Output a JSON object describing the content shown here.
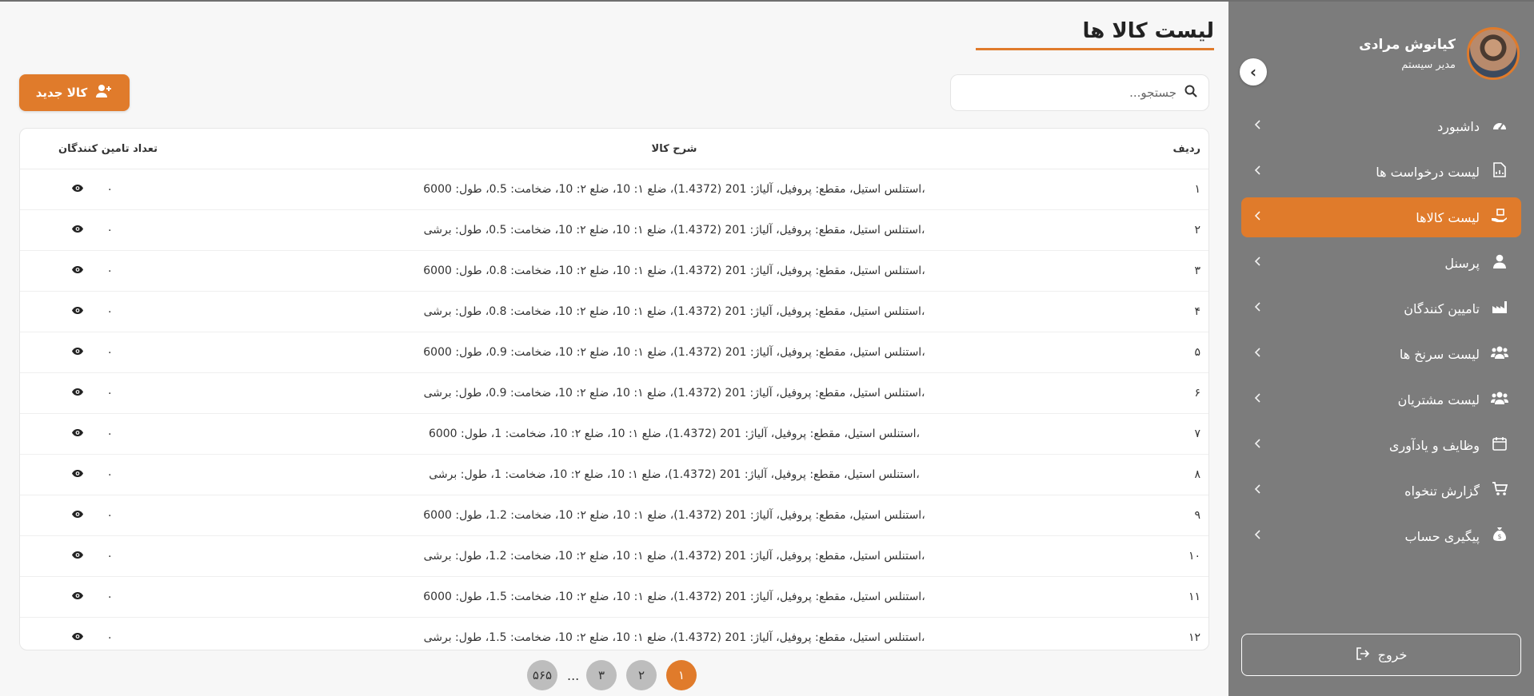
{
  "sidebar": {
    "profile": {
      "name": "کیانوش مرادی",
      "role": "مدیر سیستم"
    },
    "collapse_glyph": "‹",
    "items": [
      {
        "label": "داشبورد",
        "icon": "dashboard-icon"
      },
      {
        "label": "لیست درخواست ها",
        "icon": "document-icon"
      },
      {
        "label": "لیست کالاها",
        "icon": "hand-box-icon",
        "active": true
      },
      {
        "label": "پرسنل",
        "icon": "user-icon"
      },
      {
        "label": "تامیین کنندگان",
        "icon": "factory-icon"
      },
      {
        "label": "لیست سرنخ ها",
        "icon": "users-icon"
      },
      {
        "label": "لیست مشتریان",
        "icon": "users-icon"
      },
      {
        "label": "وظایف و یادآوری",
        "icon": "calendar-icon"
      },
      {
        "label": "گزارش تنخواه",
        "icon": "cart-icon"
      },
      {
        "label": "پیگیری حساب",
        "icon": "money-bag-icon"
      }
    ],
    "logout_label": "خروج"
  },
  "header": {
    "title": "لیست کالا ها"
  },
  "search": {
    "placeholder": "جستجو..."
  },
  "toolbar": {
    "new_label": "کالا جدید"
  },
  "table": {
    "columns": {
      "index": "ردیف",
      "description": "شرح کالا",
      "suppliers": "تعداد تامین کنندگان"
    },
    "rows": [
      {
        "index": "۱",
        "description": "استنلس استیل، مقطع: پروفیل، آلیاژ: 201 (1.4372)، ضلع ۱: 10، ضلع ۲: 10، ضخامت: 0.5، طول: 6000،",
        "suppliers": "۰"
      },
      {
        "index": "۲",
        "description": "استنلس استیل، مقطع: پروفیل، آلیاژ: 201 (1.4372)، ضلع ۱: 10، ضلع ۲: 10، ضخامت: 0.5، طول: برشی،",
        "suppliers": "۰"
      },
      {
        "index": "۳",
        "description": "استنلس استیل، مقطع: پروفیل، آلیاژ: 201 (1.4372)، ضلع ۱: 10، ضلع ۲: 10، ضخامت: 0.8، طول: 6000،",
        "suppliers": "۰"
      },
      {
        "index": "۴",
        "description": "استنلس استیل، مقطع: پروفیل، آلیاژ: 201 (1.4372)، ضلع ۱: 10، ضلع ۲: 10، ضخامت: 0.8، طول: برشی،",
        "suppliers": "۰"
      },
      {
        "index": "۵",
        "description": "استنلس استیل، مقطع: پروفیل، آلیاژ: 201 (1.4372)، ضلع ۱: 10، ضلع ۲: 10، ضخامت: 0.9، طول: 6000،",
        "suppliers": "۰"
      },
      {
        "index": "۶",
        "description": "استنلس استیل، مقطع: پروفیل، آلیاژ: 201 (1.4372)، ضلع ۱: 10، ضلع ۲: 10، ضخامت: 0.9، طول: برشی،",
        "suppliers": "۰"
      },
      {
        "index": "۷",
        "description": "استنلس استیل، مقطع: پروفیل، آلیاژ: 201 (1.4372)، ضلع ۱: 10، ضلع ۲: 10، ضخامت: 1، طول: 6000،",
        "suppliers": "۰"
      },
      {
        "index": "۸",
        "description": "استنلس استیل، مقطع: پروفیل، آلیاژ: 201 (1.4372)، ضلع ۱: 10، ضلع ۲: 10، ضخامت: 1، طول: برشی،",
        "suppliers": "۰"
      },
      {
        "index": "۹",
        "description": "استنلس استیل، مقطع: پروفیل، آلیاژ: 201 (1.4372)، ضلع ۱: 10، ضلع ۲: 10، ضخامت: 1.2، طول: 6000،",
        "suppliers": "۰"
      },
      {
        "index": "۱۰",
        "description": "استنلس استیل، مقطع: پروفیل، آلیاژ: 201 (1.4372)، ضلع ۱: 10، ضلع ۲: 10، ضخامت: 1.2، طول: برشی،",
        "suppliers": "۰"
      },
      {
        "index": "۱۱",
        "description": "استنلس استیل، مقطع: پروفیل، آلیاژ: 201 (1.4372)، ضلع ۱: 10، ضلع ۲: 10، ضخامت: 1.5، طول: 6000،",
        "suppliers": "۰"
      },
      {
        "index": "۱۲",
        "description": "استنلس استیل، مقطع: پروفیل، آلیاژ: 201 (1.4372)، ضلع ۱: 10، ضلع ۲: 10، ضخامت: 1.5، طول: برشی،",
        "suppliers": "۰"
      }
    ]
  },
  "pagination": {
    "pages": [
      "۱",
      "۲",
      "۳",
      "...",
      "۵۶۵"
    ],
    "active": "۱"
  },
  "colors": {
    "accent": "#e07b2b",
    "sidebar_bg": "#7c7c7c",
    "page_bg": "#f7f7f7"
  }
}
